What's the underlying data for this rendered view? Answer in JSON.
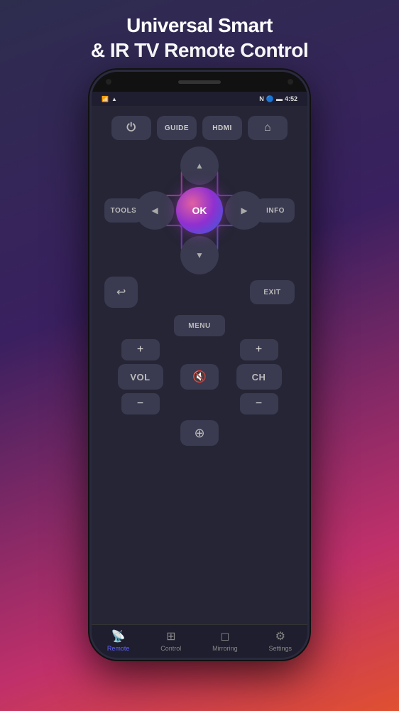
{
  "header": {
    "title": "Universal Smart\n& IR TV Remote Control"
  },
  "status_bar": {
    "time": "4:52",
    "left_icons": [
      "sim",
      "wifi"
    ],
    "right_icons": [
      "nfc",
      "bluetooth",
      "battery"
    ]
  },
  "remote": {
    "top_buttons": [
      {
        "label": "⏻",
        "type": "icon",
        "name": "power"
      },
      {
        "label": "GUIDE",
        "type": "text",
        "name": "guide"
      },
      {
        "label": "HDMI",
        "type": "text",
        "name": "hdmi"
      },
      {
        "label": "⌂",
        "type": "icon",
        "name": "home"
      }
    ],
    "side_left": "TOOLS",
    "side_right": "INFO",
    "dpad": {
      "up": "▲",
      "down": "▼",
      "left": "◀",
      "right": "▶",
      "ok": "OK"
    },
    "back_label": "↩",
    "exit_label": "EXIT",
    "menu_label": "MENU",
    "vol_plus": "+",
    "vol_label": "VOL",
    "vol_minus": "−",
    "mute_label": "🔇",
    "ch_plus": "+",
    "ch_label": "CH",
    "ch_minus": "−",
    "source_label": "⊕"
  },
  "bottom_nav": {
    "items": [
      {
        "icon": "📡",
        "label": "Remote",
        "active": true
      },
      {
        "icon": "⊞",
        "label": "Control",
        "active": false
      },
      {
        "icon": "◻",
        "label": "Mirroring",
        "active": false
      },
      {
        "icon": "⚙",
        "label": "Settings",
        "active": false
      }
    ]
  }
}
